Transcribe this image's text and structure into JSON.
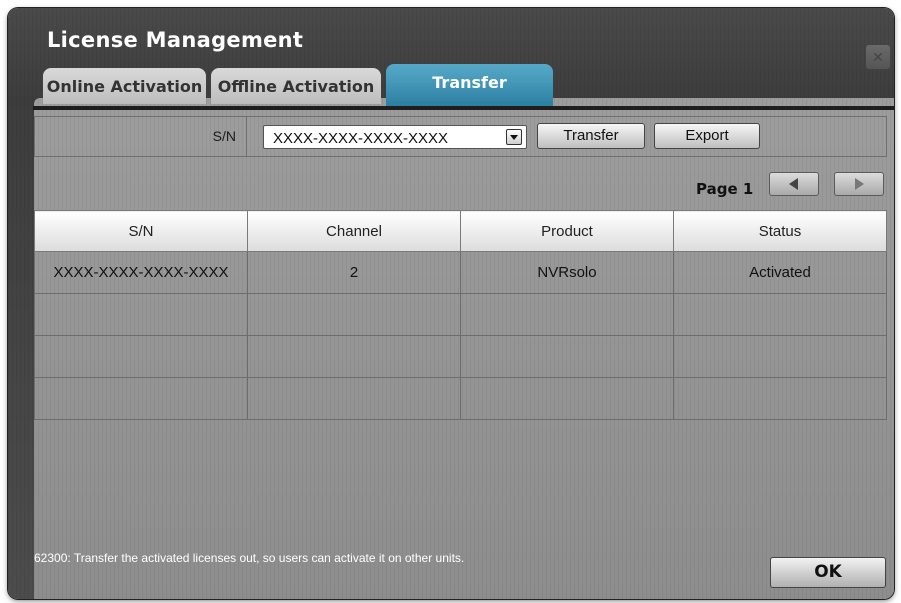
{
  "window": {
    "title": "License Management"
  },
  "tabs": [
    {
      "label": "Online Activation",
      "active": false
    },
    {
      "label": "Offline Activation",
      "active": false
    },
    {
      "label": "Transfer",
      "active": true
    }
  ],
  "serial": {
    "label": "S/N",
    "selected_value": "XXXX-XXXX-XXXX-XXXX",
    "transfer_label": "Transfer",
    "export_label": "Export"
  },
  "pagination": {
    "label": "Page 1"
  },
  "table": {
    "headers": [
      "S/N",
      "Channel",
      "Product",
      "Status"
    ],
    "rows": [
      [
        "XXXX-XXXX-XXXX-XXXX",
        "2",
        "NVRsolo",
        "Activated"
      ],
      [
        "",
        "",
        "",
        ""
      ],
      [
        "",
        "",
        "",
        ""
      ],
      [
        "",
        "",
        "",
        ""
      ]
    ]
  },
  "footer": {
    "message": "62300: Transfer the activated licenses out, so users can activate it on other units.",
    "ok_label": "OK"
  },
  "colors": {
    "active_tab": "#2a7ea0",
    "window_bg": "#444444",
    "panel_bg": "#959595"
  }
}
